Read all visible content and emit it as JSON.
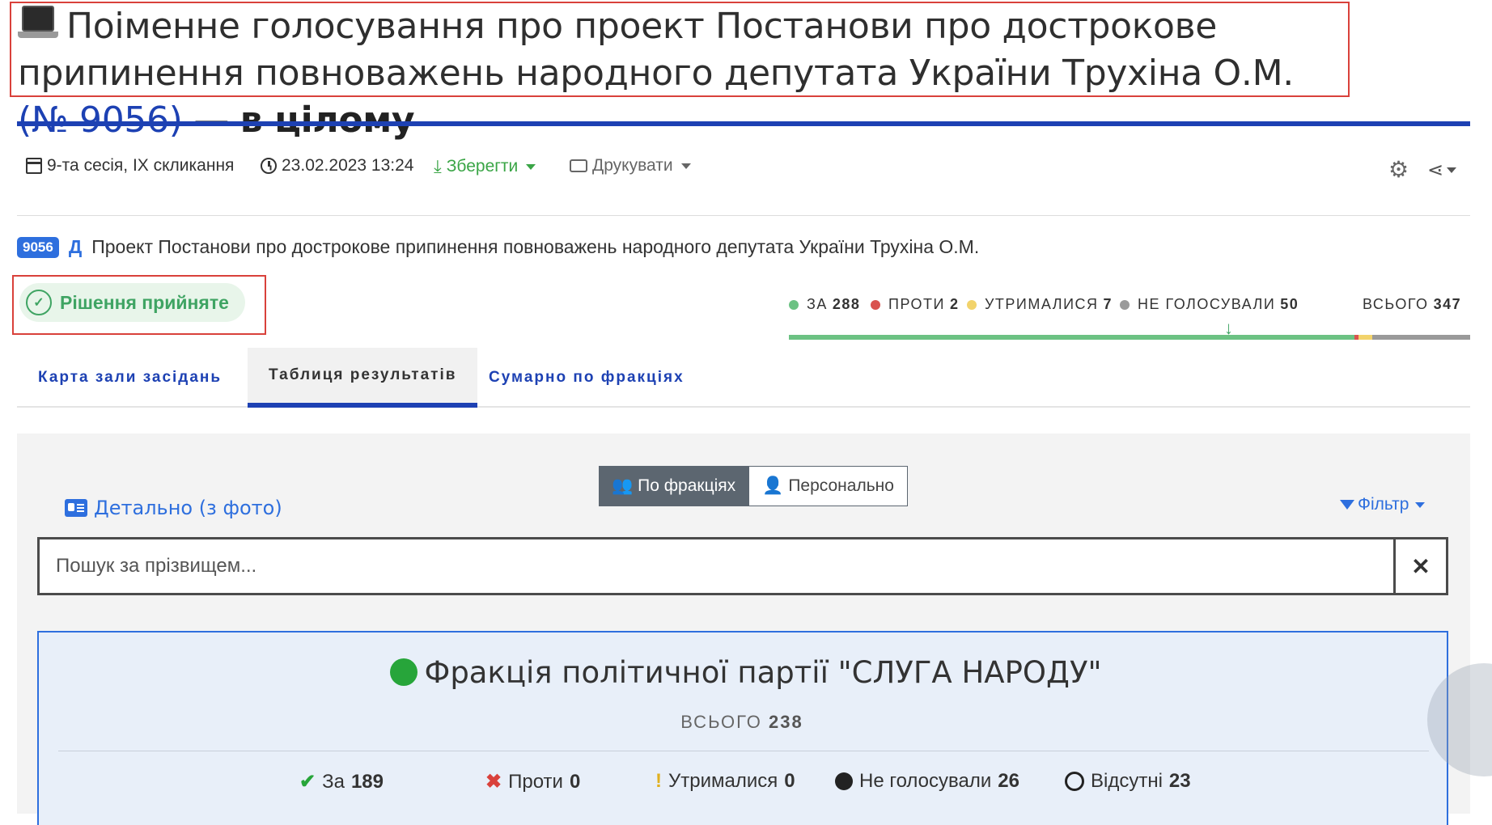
{
  "title": {
    "prefix": "Поіменне голосування про проект Постанови про дострокове припинення повноважень народного депутата України Трухіна О.М.",
    "number": "(№ 9056)",
    "dash": " — ",
    "suffix": "в цілому",
    "icon": "laptop-icon"
  },
  "meta": {
    "session": "9-та сесія, IX скликання",
    "datetime": "23.02.2023 13:24",
    "save_label": "Зберегти",
    "print_label": "Друкувати"
  },
  "bill": {
    "number": "9056",
    "type_letter": "Д",
    "name": "Проект Постанови про дострокове припинення повноважень народного депутата України Трухіна О.М."
  },
  "decision": {
    "label": "Рішення прийняте"
  },
  "tally": {
    "for_label": "ЗА",
    "for": "288",
    "against_label": "ПРОТИ",
    "against": "2",
    "abstain_label": "УТРИМАЛИСЯ",
    "abstain": "7",
    "novote_label": "НЕ ГОЛОСУВАЛИ",
    "novote": "50",
    "total_label": "ВСЬОГО",
    "total": "347",
    "colors": {
      "for": "#6cc283",
      "against": "#d9534f",
      "abstain": "#f2d36b",
      "novote": "#9a9a9a"
    }
  },
  "tabs": [
    {
      "label": "Карта зали засідань"
    },
    {
      "label": "Таблиця результатів"
    },
    {
      "label": "Сумарно по фракціях"
    }
  ],
  "view_toggle": {
    "by_faction": "По фракціях",
    "personal": "Персонально"
  },
  "detail_link": "Детально (з фото)",
  "filter_label": "Фільтр",
  "search": {
    "placeholder": "Пошук за прізвищем..."
  },
  "faction": {
    "name": "Фракція політичної партії \"СЛУГА НАРОДУ\"",
    "total_label": "ВСЬОГО",
    "total": "238",
    "for_label": "За",
    "for": "189",
    "against_label": "Проти",
    "against": "0",
    "abstain_label": "Утрималися",
    "abstain": "0",
    "novote_label": "Не голосували",
    "novote": "26",
    "absent_label": "Відсутні",
    "absent": "23"
  }
}
